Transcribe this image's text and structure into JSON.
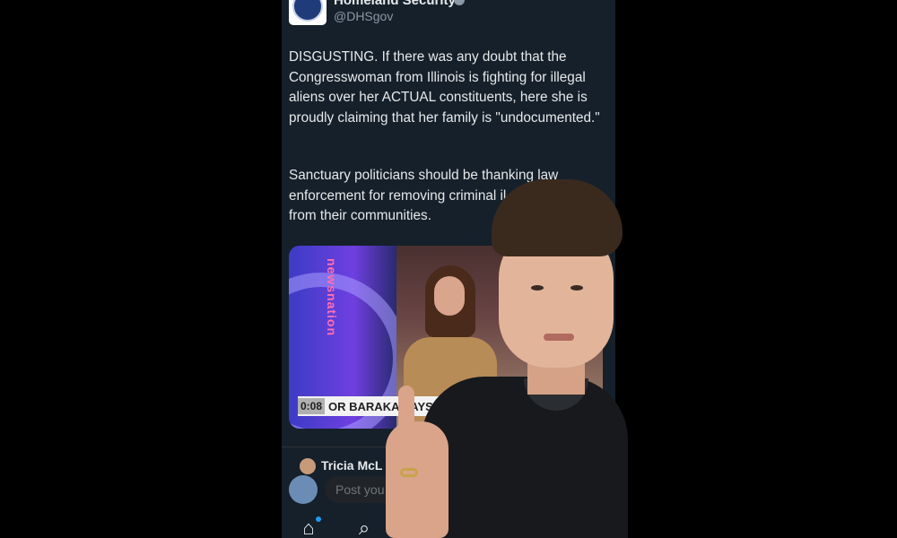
{
  "post": {
    "author_name": "Homeland Security",
    "author_handle": "@DHSgov",
    "text_paragraph_1": "DISGUSTING. If there was any doubt that the Congresswoman from Illinois is fighting for illegal aliens over her ACTUAL constituents, here she is proudly claiming that her family is \"undocumented.\"",
    "text_paragraph_2": "Sanctuary politicians should be thanking law enforcement for removing criminal il\nfrom their communities.",
    "video": {
      "time": "0:08",
      "chyron": "OR BARAKA SAYS     YAP",
      "network_logo": "newsnation"
    }
  },
  "reply_preview": {
    "name": "Tricia McL"
  },
  "composer": {
    "placeholder": "Post you"
  },
  "nav": {
    "home_icon": "⌂",
    "search_icon": "⌕"
  },
  "colors": {
    "background": "#15202b",
    "text": "#e7e9ea",
    "secondary": "#8b98a5",
    "accent": "#1d9bf0"
  }
}
